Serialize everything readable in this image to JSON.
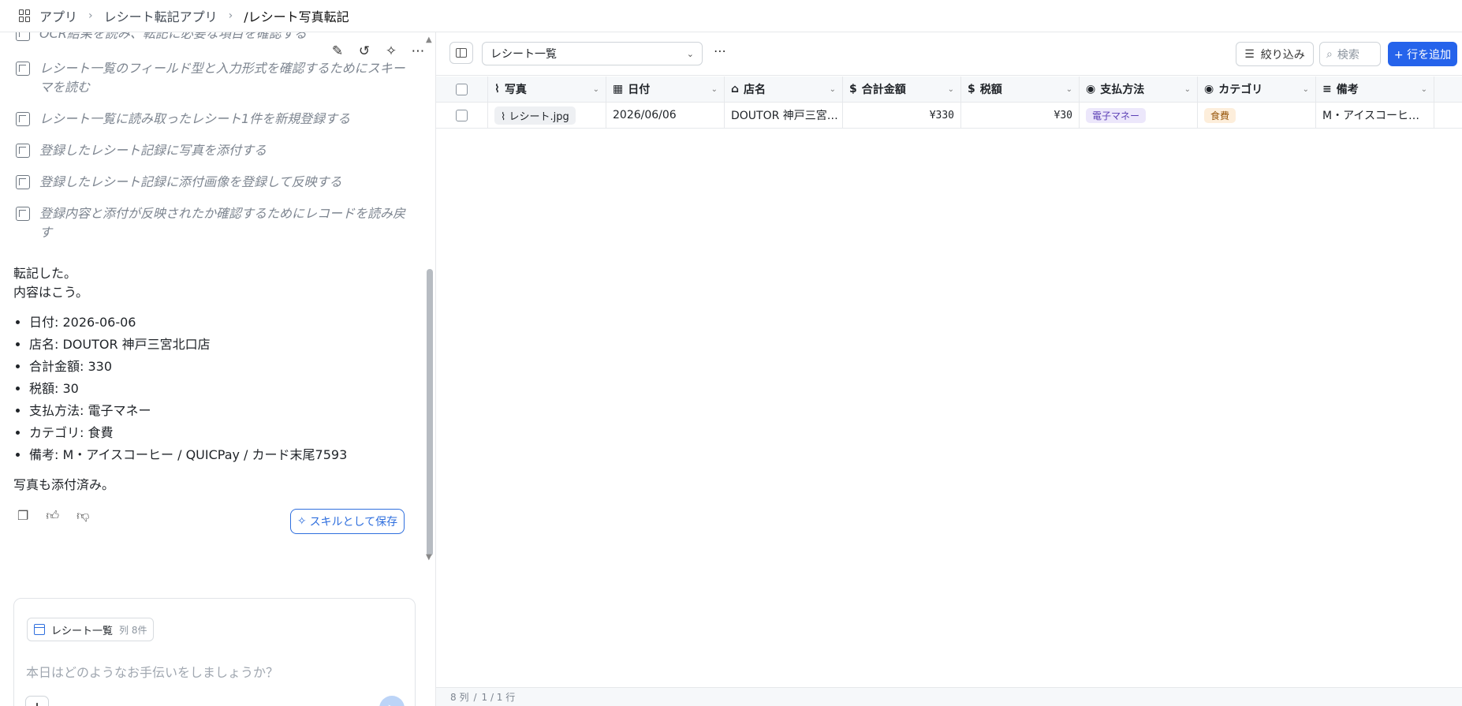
{
  "breadcrumb": {
    "apps": "アプリ",
    "app": "レシート転記アプリ",
    "current": "/レシート写真転記"
  },
  "chat": {
    "partial_step": "OCR結果を読み、転記に必要な項目を確認する",
    "steps": [
      "レシート一覧のフィールド型と入力形式を確認するためにスキーマを読む",
      "レシート一覧に読み取ったレシート1件を新規登録する",
      "登録したレシート記録に写真を添付する",
      "登録したレシート記録に添付画像を登録して反映する",
      "登録内容と添付が反映されたか確認するためにレコードを読み戻す"
    ],
    "reply_line1": "転記した。",
    "reply_line2": "内容はこう。",
    "bullets": [
      "日付: 2026-06-06",
      "店名: DOUTOR 神戸三宮北口店",
      "合計金額: 330",
      "税額: 30",
      "支払方法: 電子マネー",
      "カテゴリ: 食費",
      "備考: M・アイスコーヒー / QUICPay / カード末尾7593"
    ],
    "reply_footer": "写真も添付済み。",
    "save_skill": "スキルとして保存"
  },
  "composer": {
    "chip_label": "レシート一覧",
    "chip_meta": "列 8件",
    "placeholder": "本日はどのようなお手伝いをしましょうか？"
  },
  "toolbar": {
    "view_name": "レシート一覧",
    "filter_label": "絞り込み",
    "search_placeholder": "検索",
    "add_row_label": "+ 行を追加"
  },
  "table": {
    "columns": [
      "写真",
      "日付",
      "店名",
      "合計金額",
      "税額",
      "支払方法",
      "カテゴリ",
      "備考"
    ],
    "rows": [
      {
        "photo": "レシート.jpg",
        "date": "2026/06/06",
        "store": "DOUTOR 神戸三宮…",
        "total": "¥330",
        "tax": "¥30",
        "payment": "電子マネー",
        "category": "食費",
        "note": "M・アイスコーヒ…"
      }
    ]
  },
  "footer": {
    "columns": "8 列",
    "sep": "/",
    "rows": "1 / 1 行"
  },
  "colors": {
    "accent": "#2563eb",
    "payment_tag_bg": "#ece7fb",
    "category_tag_bg": "#fdeedb"
  }
}
